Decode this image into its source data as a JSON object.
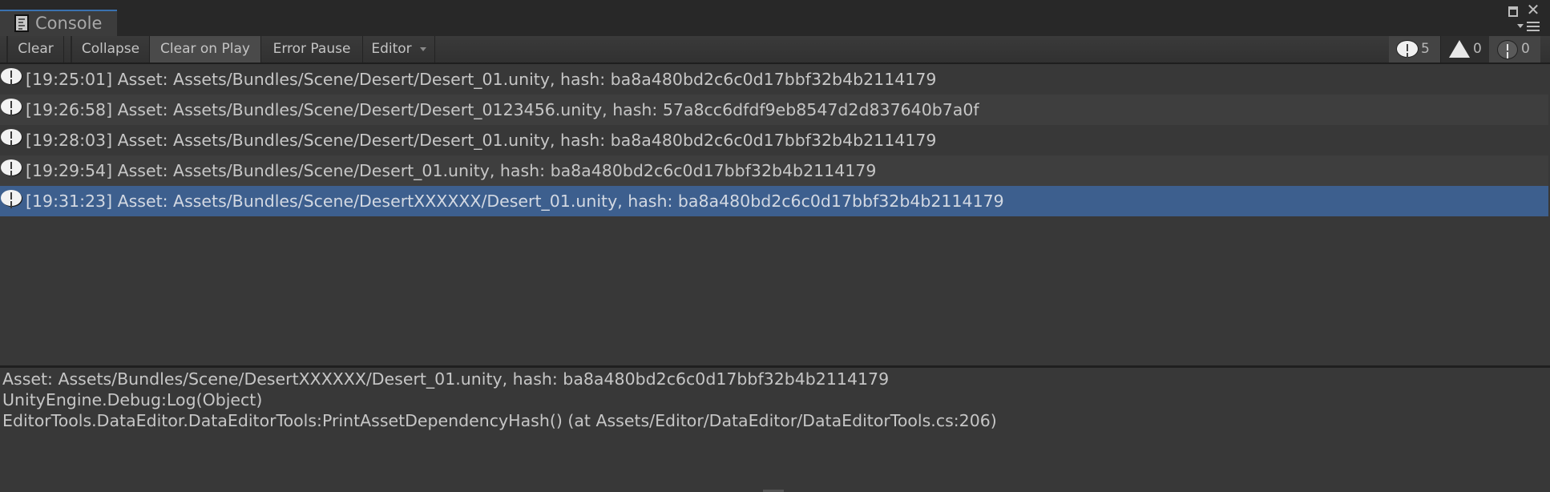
{
  "window": {
    "tab_label": "Console",
    "tab_icon": "console-document-icon",
    "controls": {
      "maximize_icon": "maximize-icon",
      "close_icon": "close-icon",
      "menu_icon": "tab-menu-icon"
    },
    "accent_color": "#3a72b0"
  },
  "toolbar": {
    "buttons": [
      {
        "label": "Clear",
        "active": false
      },
      {
        "label": "Collapse",
        "active": false
      },
      {
        "label": "Clear on Play",
        "active": true
      },
      {
        "label": "Error Pause",
        "active": false
      },
      {
        "label": "Editor",
        "active": false,
        "dropdown": true
      }
    ],
    "badges": {
      "info": {
        "icon": "info-icon",
        "count": "5",
        "enabled": true
      },
      "warning": {
        "icon": "warning-icon",
        "count": "0",
        "enabled": false
      },
      "error": {
        "icon": "error-icon",
        "count": "0",
        "enabled": true
      }
    }
  },
  "log": {
    "entries": [
      {
        "icon": "info-icon",
        "text": "[19:25:01] Asset: Assets/Bundles/Scene/Desert/Desert_01.unity, hash: ba8a480bd2c6c0d17bbf32b4b2114179"
      },
      {
        "icon": "info-icon",
        "text": "[19:26:58] Asset: Assets/Bundles/Scene/Desert/Desert_0123456.unity, hash: 57a8cc6dfdf9eb8547d2d837640b7a0f"
      },
      {
        "icon": "info-icon",
        "text": "[19:28:03] Asset: Assets/Bundles/Scene/Desert/Desert_01.unity, hash: ba8a480bd2c6c0d17bbf32b4b2114179"
      },
      {
        "icon": "info-icon",
        "text": "[19:29:54] Asset: Assets/Bundles/Scene/Desert_01.unity, hash: ba8a480bd2c6c0d17bbf32b4b2114179"
      },
      {
        "icon": "info-icon",
        "text": "[19:31:23] Asset: Assets/Bundles/Scene/DesertXXXXXX/Desert_01.unity, hash: ba8a480bd2c6c0d17bbf32b4b2114179"
      }
    ],
    "selected_index": 4,
    "selected_color": "#3d5f8e"
  },
  "detail": {
    "lines": [
      "Asset: Assets/Bundles/Scene/DesertXXXXXX/Desert_01.unity, hash: ba8a480bd2c6c0d17bbf32b4b2114179",
      "UnityEngine.Debug:Log(Object)",
      "EditorTools.DataEditor.DataEditorTools:PrintAssetDependencyHash() (at Assets/Editor/DataEditor/DataEditorTools.cs:206)"
    ]
  }
}
